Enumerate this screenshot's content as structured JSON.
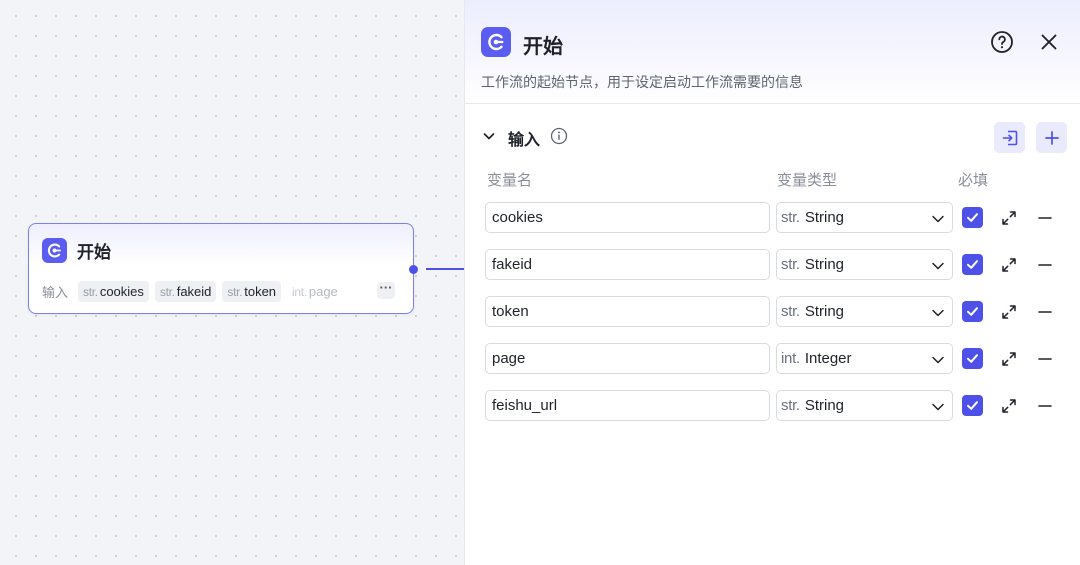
{
  "node": {
    "title": "开始",
    "inputs_label": "输入",
    "chips": [
      {
        "type": "str.",
        "name": "cookies"
      },
      {
        "type": "str.",
        "name": "fakeid"
      },
      {
        "type": "str.",
        "name": "token"
      },
      {
        "type": "int.",
        "name": "page"
      }
    ],
    "more_label": "···"
  },
  "panel": {
    "title": "开始",
    "description": "工作流的起始节点，用于设定启动工作流需要的信息",
    "section_title": "输入",
    "columns": {
      "name": "变量名",
      "type": "变量类型",
      "required": "必填"
    },
    "rows": [
      {
        "name": "cookies",
        "type_prefix": "str.",
        "type": "String",
        "required": true
      },
      {
        "name": "fakeid",
        "type_prefix": "str.",
        "type": "String",
        "required": true
      },
      {
        "name": "token",
        "type_prefix": "str.",
        "type": "String",
        "required": true
      },
      {
        "name": "page",
        "type_prefix": "int.",
        "type": "Integer",
        "required": true
      },
      {
        "name": "feishu_url",
        "type_prefix": "str.",
        "type": "String",
        "required": true
      }
    ]
  },
  "icons": {
    "logo": "start-logo-icon",
    "help": "question-circle-icon",
    "close": "close-icon",
    "collapse": "chevron-down-icon",
    "info": "info-icon",
    "import": "import-icon",
    "add": "plus-icon",
    "expand": "expand-icon",
    "remove": "minus-icon"
  },
  "colors": {
    "accent": "#4e51e8",
    "logo": "#5a5df0",
    "chip_bg": "#eef0f4"
  }
}
